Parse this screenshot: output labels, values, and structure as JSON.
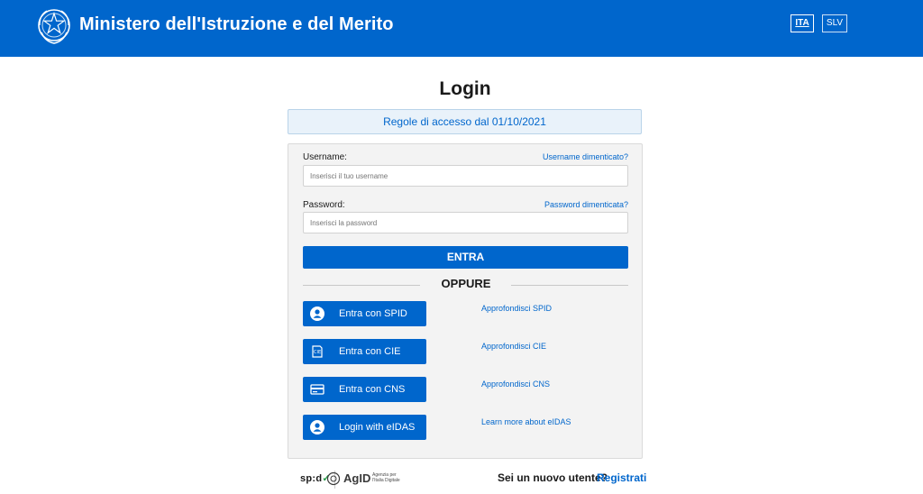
{
  "header": {
    "title": "Ministero dell'Istruzione e del Merito",
    "lang_active": "ITA",
    "lang_other": "SLV"
  },
  "page_title": "Login",
  "rules_notice": "Regole di accesso dal 01/10/2021",
  "form": {
    "username_label": "Username:",
    "username_forgot": "Username dimenticato?",
    "username_placeholder": "Inserisci il tuo username",
    "username_value": "",
    "password_label": "Password:",
    "password_forgot": "Password dimenticata?",
    "password_placeholder": "Inserisci la password",
    "password_value": "",
    "submit_label": "ENTRA",
    "separator_label": "OPPURE"
  },
  "auth_options": [
    {
      "button_label": "Entra con SPID",
      "link_label": "Approfondisci SPID",
      "icon": "user-icon"
    },
    {
      "button_label": "Entra con CIE",
      "link_label": "Approfondisci CIE",
      "icon": "id-card-icon"
    },
    {
      "button_label": "Entra con CNS",
      "link_label": "Approfondisci CNS",
      "icon": "smart-card-icon"
    },
    {
      "button_label": "Login with eIDAS",
      "link_label": "Learn more about eIDAS",
      "icon": "user-icon"
    }
  ],
  "footer": {
    "spid_logo_text": "sp:d",
    "agid_logo_text": "AgID",
    "agid_subtitle": "Agenzia per l'Italia Digitale",
    "new_user_text": "Sei un nuovo utente?",
    "register_link": "Registrati"
  },
  "colors": {
    "brand_blue": "#0066cc",
    "card_bg": "#f3f3f3",
    "notice_bg": "#e9f2fa"
  }
}
